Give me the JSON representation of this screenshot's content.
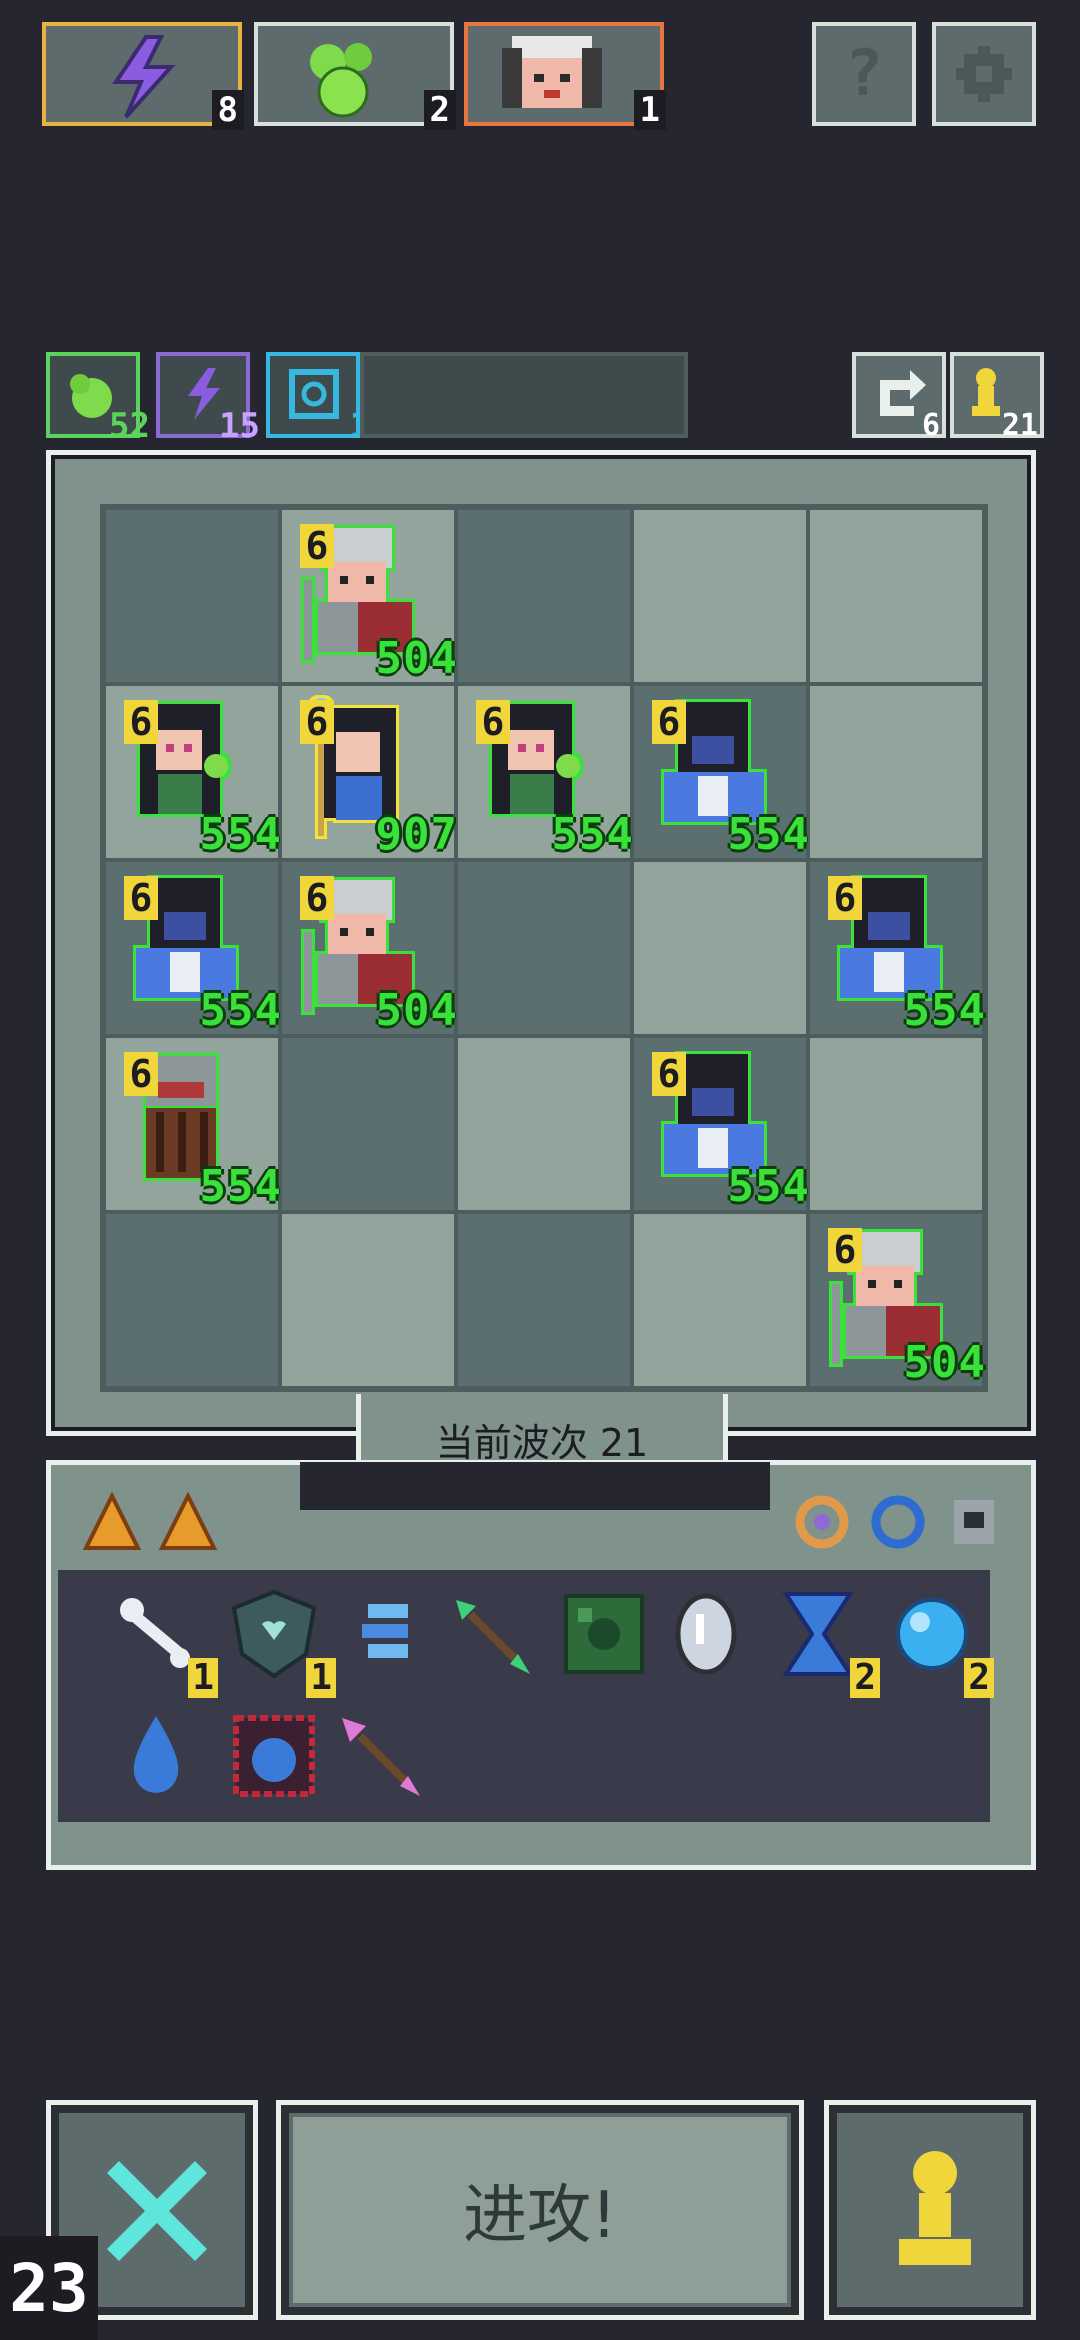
{
  "resources": [
    {
      "name": "energy",
      "count": "8",
      "icon": "lightning-icon",
      "border": "#e8b33f"
    },
    {
      "name": "slime",
      "count": "2",
      "icon": "green-slime-icon",
      "border": "#d8e0dc"
    },
    {
      "name": "hero",
      "count": "1",
      "icon": "hero-portrait-icon",
      "border": "#e6763e"
    }
  ],
  "top_buttons": {
    "help": "help-icon",
    "settings": "gear-icon"
  },
  "stats": [
    {
      "name": "slime-stat",
      "value": "52",
      "color": "#5bd45b"
    },
    {
      "name": "energy-stat",
      "value": "15",
      "color": "#b48be0"
    },
    {
      "name": "shield-stat",
      "value": "1",
      "color": "#36b8e0"
    }
  ],
  "right_stats": {
    "refresh": "6",
    "pawn": "21"
  },
  "board": {
    "units": [
      {
        "row": 0,
        "col": 1,
        "type": "armored-soldier",
        "level": "6",
        "hp": "504"
      },
      {
        "row": 1,
        "col": 0,
        "type": "dark-haired-mage",
        "level": "6",
        "hp": "554"
      },
      {
        "row": 1,
        "col": 1,
        "type": "staff-priestess",
        "level": "6",
        "hp": "907",
        "selected": true
      },
      {
        "row": 1,
        "col": 2,
        "type": "dark-haired-mage",
        "level": "6",
        "hp": "554"
      },
      {
        "row": 1,
        "col": 3,
        "type": "hooded-ghost",
        "level": "6",
        "hp": "554"
      },
      {
        "row": 2,
        "col": 0,
        "type": "hooded-ghost",
        "level": "6",
        "hp": "554"
      },
      {
        "row": 2,
        "col": 1,
        "type": "armored-soldier",
        "level": "6",
        "hp": "504"
      },
      {
        "row": 2,
        "col": 4,
        "type": "hooded-ghost",
        "level": "6",
        "hp": "554"
      },
      {
        "row": 3,
        "col": 0,
        "type": "knight-shield",
        "level": "6",
        "hp": "554"
      },
      {
        "row": 3,
        "col": 3,
        "type": "hooded-ghost",
        "level": "6",
        "hp": "554"
      },
      {
        "row": 4,
        "col": 4,
        "type": "armored-soldier",
        "level": "6",
        "hp": "504"
      }
    ]
  },
  "wave": {
    "label": "当前波次 21"
  },
  "inventory": {
    "cards": [
      "cheese-card-icon",
      "cheese-card-icon"
    ],
    "gems": [
      "orange-ring-icon",
      "blue-ring-icon",
      "helmet-icon"
    ],
    "items": [
      {
        "icon": "bone-icon",
        "count": "1"
      },
      {
        "icon": "heart-shield-icon",
        "count": "1"
      },
      {
        "icon": "blue-claw-icon",
        "count": ""
      },
      {
        "icon": "green-arrow-icon",
        "count": ""
      },
      {
        "icon": "moss-tile-icon",
        "count": ""
      },
      {
        "icon": "mirror-icon",
        "count": ""
      },
      {
        "icon": "hourglass-icon",
        "count": "2"
      },
      {
        "icon": "blue-orb-icon",
        "count": "2"
      },
      {
        "icon": "water-drop-icon",
        "count": ""
      },
      {
        "icon": "fire-tile-icon",
        "count": ""
      },
      {
        "icon": "pink-arrow-icon",
        "count": ""
      }
    ]
  },
  "bottom": {
    "attack_label": "进攻!",
    "corner_number": "23"
  }
}
